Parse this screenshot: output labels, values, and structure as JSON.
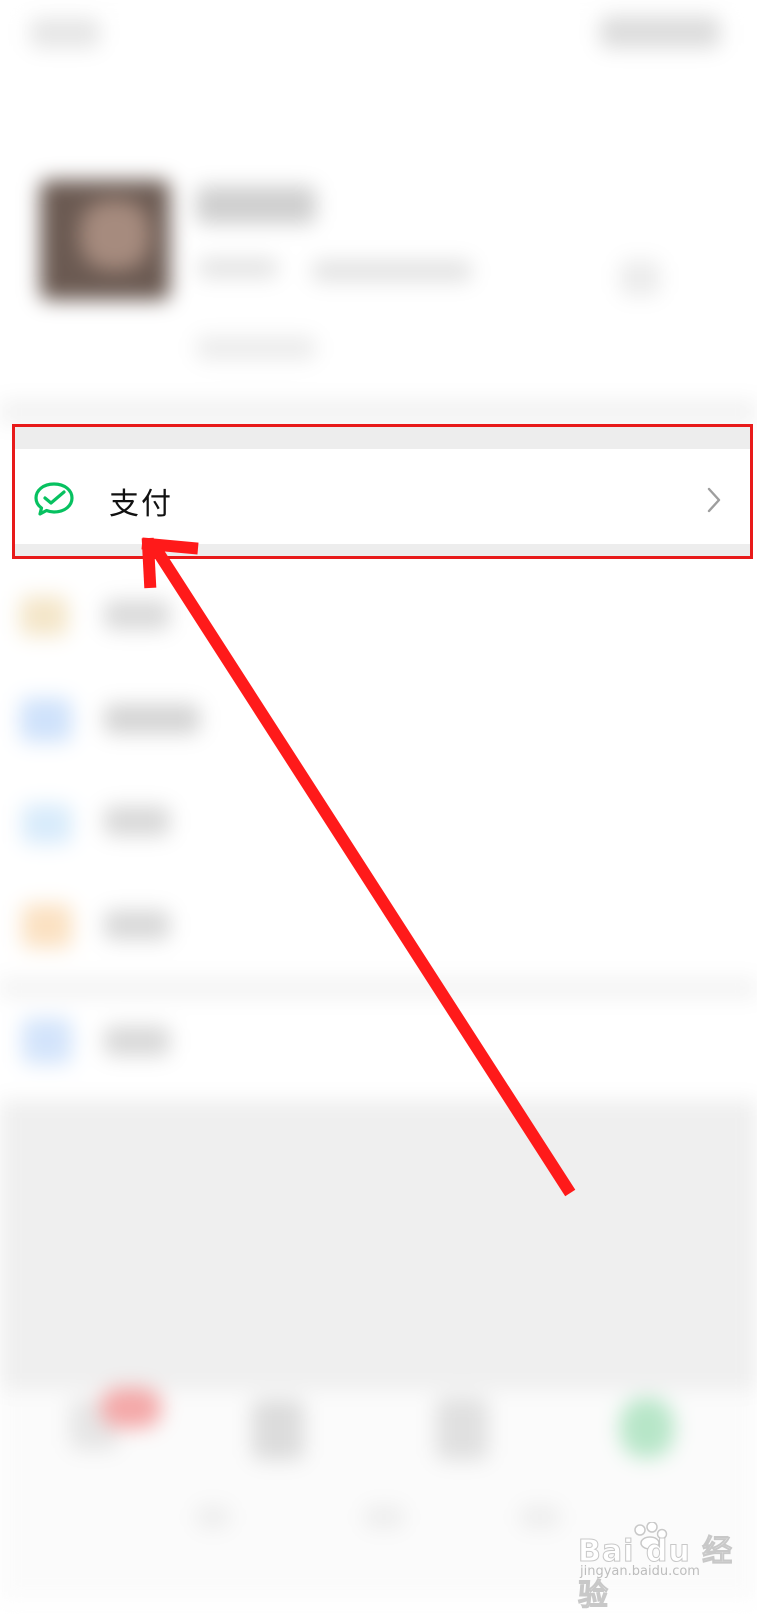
{
  "payment_row": {
    "label": "支付",
    "icon": "wechat-pay-icon",
    "chevron": "chevron-right-icon"
  },
  "watermark": {
    "brand": "Bai du 经验",
    "url": "jingyan.baidu.com"
  },
  "colors": {
    "highlight": "#e81a1a",
    "wechat_green": "#07c160",
    "page_bg": "#ededed"
  }
}
